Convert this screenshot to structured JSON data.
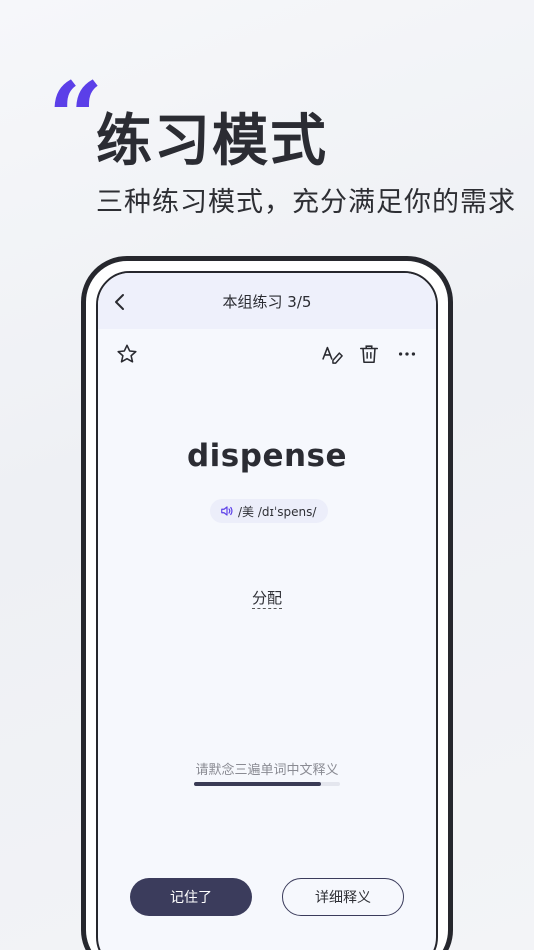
{
  "hero": {
    "quote_mark": "“",
    "title": "练习模式",
    "subtitle": "三种练习模式，充分满足你的需求"
  },
  "navbar": {
    "title": "本组练习  3/5"
  },
  "toolbar": {
    "icons": [
      "star-icon",
      "spell-icon",
      "trash-icon",
      "more-icon"
    ]
  },
  "card": {
    "word": "dispense",
    "phonetic": "/美  /dɪˈspens/",
    "meaning": "分配",
    "hint": "请默念三遍单词中文释义",
    "progress": 0.87
  },
  "actions": {
    "remembered": "记住了",
    "details": "详细释义"
  },
  "colors": {
    "accent": "#5b3fe8",
    "primary_button": "#3b3c5c",
    "navbar_bg": "#eef0fb"
  }
}
